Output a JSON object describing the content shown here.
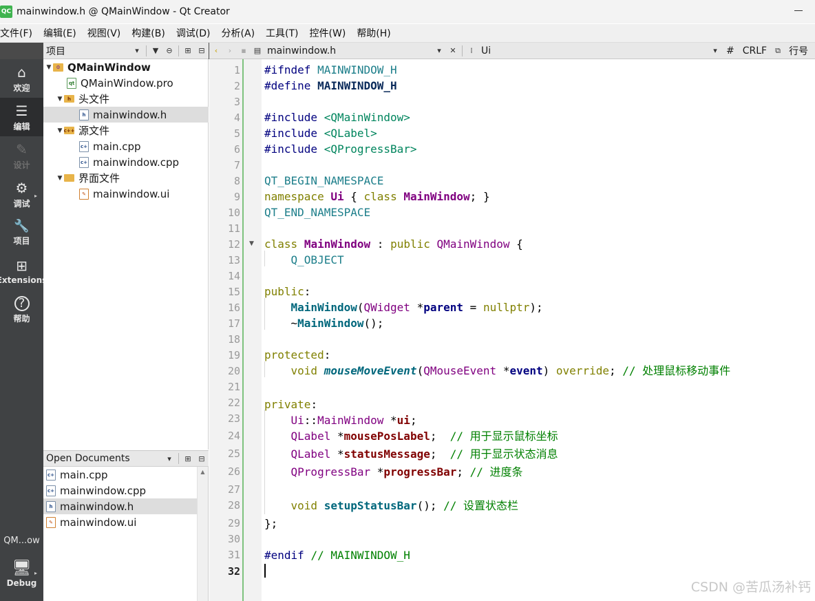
{
  "window": {
    "app_icon": "QC",
    "title": "mainwindow.h @ QMainWindow - Qt Creator"
  },
  "menubar": [
    "文件(F)",
    "编辑(E)",
    "视图(V)",
    "构建(B)",
    "调试(D)",
    "分析(A)",
    "工具(T)",
    "控件(W)",
    "帮助(H)"
  ],
  "project_panel": {
    "title": "项目",
    "items": [
      {
        "label": "QMainWindow",
        "icon": "project-icon",
        "icon_text": "⚙",
        "caret": "▼"
      },
      {
        "label": "QMainWindow.pro",
        "icon": "pro-file-icon",
        "icon_text": "qt",
        "caret": ""
      },
      {
        "label": "头文件",
        "icon": "header-folder-icon",
        "icon_text": "h",
        "caret": "▼"
      },
      {
        "label": "mainwindow.h",
        "icon": "header-file-icon",
        "icon_text": "h",
        "caret": ""
      },
      {
        "label": "源文件",
        "icon": "source-folder-icon",
        "icon_text": "c++",
        "caret": "▼"
      },
      {
        "label": "main.cpp",
        "icon": "cpp-file-icon",
        "icon_text": "c+",
        "caret": ""
      },
      {
        "label": "mainwindow.cpp",
        "icon": "cpp-file-icon",
        "icon_text": "c+",
        "caret": ""
      },
      {
        "label": "界面文件",
        "icon": "form-folder-icon",
        "icon_text": "",
        "caret": "▼"
      },
      {
        "label": "mainwindow.ui",
        "icon": "ui-file-icon",
        "icon_text": "✎",
        "caret": ""
      }
    ]
  },
  "open_documents": {
    "title": "Open Documents",
    "items": [
      {
        "label": "main.cpp",
        "icon_text": "c+"
      },
      {
        "label": "mainwindow.cpp",
        "icon_text": "c+"
      },
      {
        "label": "mainwindow.h",
        "icon_text": "h"
      },
      {
        "label": "mainwindow.ui",
        "icon_text": "✎"
      }
    ]
  },
  "modes": [
    {
      "label": "欢迎",
      "icon": "welcome-icon",
      "glyph": "⌂"
    },
    {
      "label": "编辑",
      "icon": "edit-icon",
      "glyph": "☰"
    },
    {
      "label": "设计",
      "icon": "design-icon",
      "glyph": "✎"
    },
    {
      "label": "调试",
      "icon": "debug-icon",
      "glyph": "⚙"
    },
    {
      "label": "项目",
      "icon": "projects-icon",
      "glyph": "🔧"
    },
    {
      "label": "Extensions",
      "icon": "extensions-icon",
      "glyph": "⊞"
    },
    {
      "label": "帮助",
      "icon": "help-icon",
      "glyph": "?"
    }
  ],
  "kit": {
    "name": "QM...ow",
    "build": "Debug"
  },
  "editor_toolbar": {
    "filename": "mainwindow.h",
    "symbol": "Ui",
    "hash": "#",
    "line_ending": "CRLF",
    "line_label": "行号"
  },
  "editor": {
    "current_line": 32,
    "lines": [
      "1",
      "2",
      "3",
      "4",
      "5",
      "6",
      "7",
      "8",
      "9",
      "10",
      "11",
      "12",
      "13",
      "14",
      "15",
      "16",
      "17",
      "18",
      "19",
      "20",
      "21",
      "22",
      "23",
      "24",
      "25",
      "26",
      "27",
      "28",
      "29",
      "30",
      "31",
      "32"
    ]
  },
  "watermark": "CSDN @苦瓜汤补钙"
}
